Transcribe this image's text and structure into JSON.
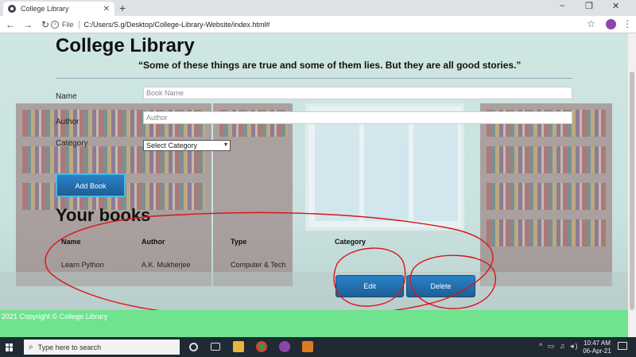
{
  "browser": {
    "tab_title": "College Library",
    "tab_close": "✕",
    "new_tab": "+",
    "window_controls": {
      "minimize": "–",
      "restore": "❐",
      "close": "✕"
    },
    "nav": {
      "back": "←",
      "forward": "→",
      "reload": "↻"
    },
    "address": {
      "scheme": "File",
      "url": "C:/Users/S.g/Desktop/College-Library-Website/index.html#"
    }
  },
  "page": {
    "title": "College Library",
    "quote": "“Some of these things are true and some of them lies. But they are all good stories.”",
    "form": {
      "name_label": "Name",
      "name_placeholder": "Book Name",
      "author_label": "Author",
      "author_placeholder": "Author",
      "category_label": "Category",
      "category_selected": "Select Category",
      "submit_label": "Add Book"
    },
    "books_title": "Your books",
    "table": {
      "headers": [
        "Name",
        "Author",
        "Type",
        "Category"
      ],
      "rows": [
        {
          "name": "Learn Python",
          "author": "A.K. Mukherjee",
          "type": "Computer & Tech",
          "edit_label": "Edit",
          "delete_label": "Delete"
        }
      ]
    },
    "footer": "2021 Copyright © College Library"
  },
  "colors": {
    "footer": "#6fe38e",
    "button": "#1d6fae",
    "annotation": "#d9151b"
  },
  "taskbar": {
    "search_placeholder": "Type here to search",
    "time": "10:47 AM",
    "date": "06-Apr-21"
  }
}
